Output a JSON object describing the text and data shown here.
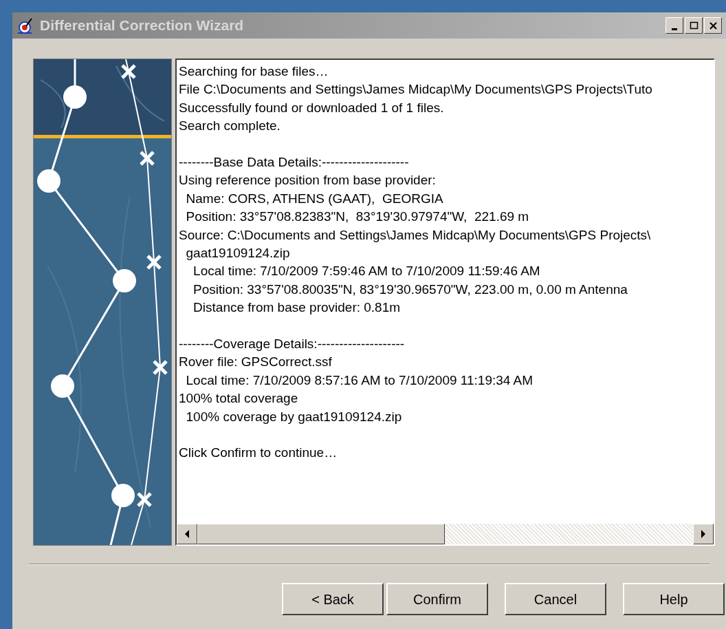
{
  "window": {
    "title": "Differential Correction Wizard"
  },
  "log": {
    "blocks": [
      [
        "Searching for base files…",
        "File C:\\Documents and Settings\\James Midcap\\My Documents\\GPS Projects\\Tuto",
        "Successfully found or downloaded 1 of 1 files.",
        "Search complete."
      ],
      [
        "--------Base Data Details:--------------------",
        "Using reference position from base provider:",
        "  Name: CORS, ATHENS (GAAT),  GEORGIA",
        "  Position: 33°57'08.82383\"N,  83°19'30.97974\"W,  221.69 m",
        "Source: C:\\Documents and Settings\\James Midcap\\My Documents\\GPS Projects\\",
        "  gaat19109124.zip",
        "    Local time: 7/10/2009 7:59:46 AM to 7/10/2009 11:59:46 AM",
        "    Position: 33°57'08.80035\"N, 83°19'30.96570\"W, 223.00 m, 0.00 m Antenna",
        "    Distance from base provider: 0.81m"
      ],
      [
        "--------Coverage Details:--------------------",
        "Rover file: GPSCorrect.ssf",
        "  Local time: 7/10/2009 8:57:16 AM to 7/10/2009 11:19:34 AM",
        "100% total coverage",
        "  100% coverage by gaat19109124.zip"
      ],
      [
        "Click Confirm to continue…"
      ]
    ]
  },
  "buttons": [
    {
      "label": "< Back"
    },
    {
      "label": "Confirm"
    },
    {
      "label": "Cancel"
    },
    {
      "label": "Help"
    }
  ]
}
